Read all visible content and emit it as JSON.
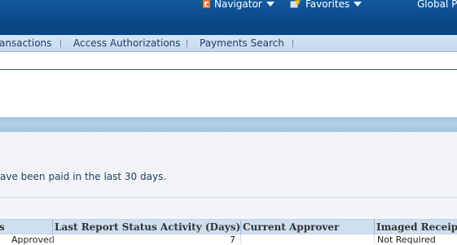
{
  "header": {
    "navigator_label": "Navigator",
    "favorites_label": "Favorites",
    "title": "Global P",
    "icons": {
      "navigator": "navigator-icon",
      "favorites": "favorites-star-icon",
      "dropdown": "caret-down-icon"
    }
  },
  "tabs": [
    {
      "label": "ansactions"
    },
    {
      "label": "Access Authorizations"
    },
    {
      "label": "Payments Search"
    }
  ],
  "info": {
    "message": "ave been paid in the last 30 days."
  },
  "table": {
    "headers": [
      "s",
      "Last Report Status Activity (Days)",
      "Current Approver",
      "Imaged Receipt"
    ],
    "rows": [
      [
        "Approved",
        "7",
        "",
        "Not Required"
      ]
    ]
  },
  "colors": {
    "header_bg": "#0c4c8a",
    "tab_bar": "#c9dbee",
    "band": "#a9c8e4",
    "panel_bg": "#f1f3f7",
    "table_header": "#cfdfee"
  }
}
